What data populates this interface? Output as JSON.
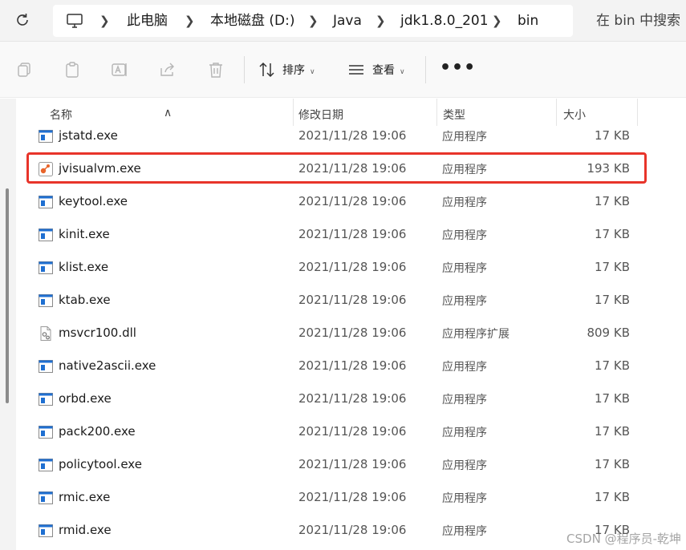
{
  "address_bar": {
    "breadcrumbs": [
      "此电脑",
      "本地磁盘 (D:)",
      "Java",
      "jdk1.8.0_201",
      "bin"
    ],
    "search_placeholder": "在 bin 中搜索"
  },
  "toolbar": {
    "sort_label": "排序",
    "view_label": "查看",
    "more_label": "•••"
  },
  "columns": {
    "name": "名称",
    "modified": "修改日期",
    "type": "类型",
    "size": "大小"
  },
  "files": [
    {
      "name": "jstatd.exe",
      "modified": "2021/11/28 19:06",
      "type": "应用程序",
      "size": "17 KB",
      "icon": "exe-icon"
    },
    {
      "name": "jvisualvm.exe",
      "modified": "2021/11/28 19:06",
      "type": "应用程序",
      "size": "193 KB",
      "icon": "jvisualvm-icon",
      "highlighted": true
    },
    {
      "name": "keytool.exe",
      "modified": "2021/11/28 19:06",
      "type": "应用程序",
      "size": "17 KB",
      "icon": "exe-icon"
    },
    {
      "name": "kinit.exe",
      "modified": "2021/11/28 19:06",
      "type": "应用程序",
      "size": "17 KB",
      "icon": "exe-icon"
    },
    {
      "name": "klist.exe",
      "modified": "2021/11/28 19:06",
      "type": "应用程序",
      "size": "17 KB",
      "icon": "exe-icon"
    },
    {
      "name": "ktab.exe",
      "modified": "2021/11/28 19:06",
      "type": "应用程序",
      "size": "17 KB",
      "icon": "exe-icon"
    },
    {
      "name": "msvcr100.dll",
      "modified": "2021/11/28 19:06",
      "type": "应用程序扩展",
      "size": "809 KB",
      "icon": "dll-icon"
    },
    {
      "name": "native2ascii.exe",
      "modified": "2021/11/28 19:06",
      "type": "应用程序",
      "size": "17 KB",
      "icon": "exe-icon"
    },
    {
      "name": "orbd.exe",
      "modified": "2021/11/28 19:06",
      "type": "应用程序",
      "size": "17 KB",
      "icon": "exe-icon"
    },
    {
      "name": "pack200.exe",
      "modified": "2021/11/28 19:06",
      "type": "应用程序",
      "size": "17 KB",
      "icon": "exe-icon"
    },
    {
      "name": "policytool.exe",
      "modified": "2021/11/28 19:06",
      "type": "应用程序",
      "size": "17 KB",
      "icon": "exe-icon"
    },
    {
      "name": "rmic.exe",
      "modified": "2021/11/28 19:06",
      "type": "应用程序",
      "size": "17 KB",
      "icon": "exe-icon"
    },
    {
      "name": "rmid.exe",
      "modified": "2021/11/28 19:06",
      "type": "应用程序",
      "size": "17 KB",
      "icon": "exe-icon"
    }
  ],
  "watermark": "CSDN @程序员-乾坤",
  "colors": {
    "highlight_border": "#e8342a",
    "exe_icon_blue": "#1f6fd1"
  }
}
